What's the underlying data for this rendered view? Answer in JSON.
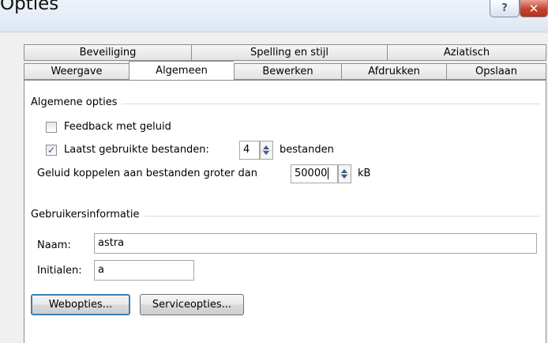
{
  "window": {
    "title": "Opties",
    "help_glyph": "?",
    "close_glyph": "✕"
  },
  "tabs_top": [
    {
      "label": "Beveiliging"
    },
    {
      "label": "Spelling en stijl"
    },
    {
      "label": "Aziatisch"
    }
  ],
  "tabs_bottom": [
    {
      "label": "Weergave"
    },
    {
      "label": "Algemeen",
      "active": true
    },
    {
      "label": "Bewerken"
    },
    {
      "label": "Afdrukken"
    },
    {
      "label": "Opslaan"
    }
  ],
  "general": {
    "group_label": "Algemene opties",
    "feedback_label": "Feedback met geluid",
    "feedback_checked": false,
    "recent_label": "Laatst gebruikte bestanden:",
    "recent_checked": true,
    "check_glyph": "✓",
    "recent_value": "4",
    "recent_suffix": "bestanden",
    "sound_label": "Geluid koppelen aan bestanden groter dan",
    "sound_value": "50000",
    "sound_suffix": "kB"
  },
  "user": {
    "group_label": "Gebruikersinformatie",
    "name_label": "Naam:",
    "name_value": "astra",
    "initials_label": "Initialen:",
    "initials_value": "a"
  },
  "buttons": {
    "web_options": "Webopties...",
    "service_options": "Serviceopties..."
  }
}
